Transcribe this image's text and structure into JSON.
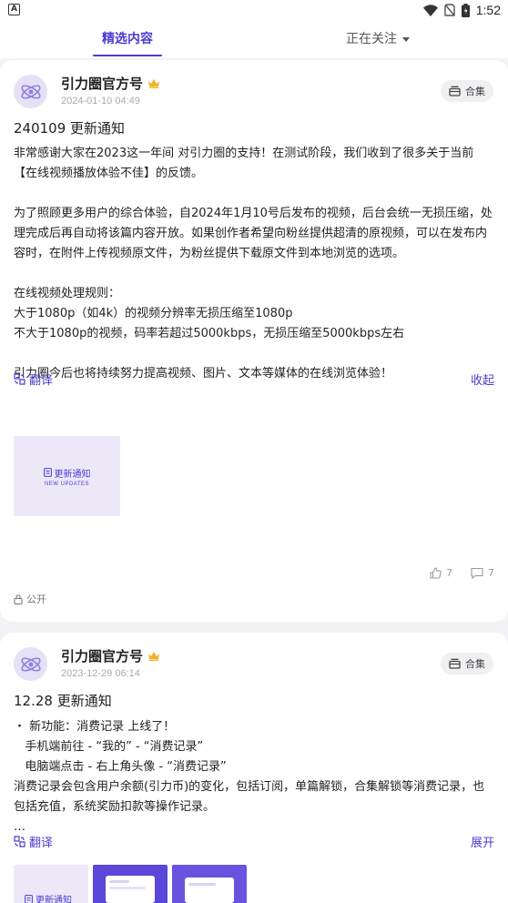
{
  "status_bar": {
    "time": "1:52",
    "app_icon_letter": "A",
    "icons": [
      "wifi-icon",
      "no-sim-icon",
      "battery-icon"
    ]
  },
  "tabs": {
    "featured": "精选内容",
    "following": "正在关注"
  },
  "posts": [
    {
      "author": "引力圈官方号",
      "date": "2024-01-10 04:49",
      "collection_label": "合集",
      "title": "240109 更新通知",
      "paragraphs": [
        "非常感谢大家在2023这一年间 对引力圈的支持！在测试阶段，我们收到了很多关于当前【在线视频播放体验不佳】的反馈。",
        "为了照顾更多用户的综合体验，自2024年1月10号后发布的视频，后台会统一无损压缩，处理完成后再自动将该篇内容开放。如果创作者希望向粉丝提供超清的原视频，可以在发布内容时，在附件上传视频原文件，为粉丝提供下载原文件到本地浏览的选项。",
        "在线视频处理规则：\n大于1080p（如4k）的视频分辨率无损压缩至1080p\n不大于1080p的视频，码率若超过5000kbps，无损压缩至5000kbps左右",
        "引力圈今后也将持续努力提高视频、图片、文本等媒体的在线浏览体验！"
      ],
      "translate_label": "翻译",
      "toggle_label": "收起",
      "image": {
        "title": "更新通知",
        "subtitle": "NEW UPDATES"
      },
      "likes": "7",
      "comments": "7",
      "visibility": "公开"
    },
    {
      "author": "引力圈官方号",
      "date": "2023-12-29 06:14",
      "collection_label": "合集",
      "title": "12.28 更新通知",
      "lines": [
        "・ 新功能：消费记录 上线了！",
        "   手机端前往 - “我的” - “消费记录”",
        "   电脑端点击 - 右上角头像 - “消费记录”"
      ],
      "body_wrap": "消费记录会包含用户余额(引力币)的变化，包括订阅，单篇解锁，合集解锁等消费记录，也包括充值，系统奖励扣款等操作记录。",
      "ellipsis": "…",
      "translate_label": "翻译",
      "toggle_label": "展开",
      "image_title": "更新通知"
    }
  ],
  "colors": {
    "accent": "#4b3ccf",
    "crown": "#f0b429",
    "background": "#f3f3f6"
  }
}
